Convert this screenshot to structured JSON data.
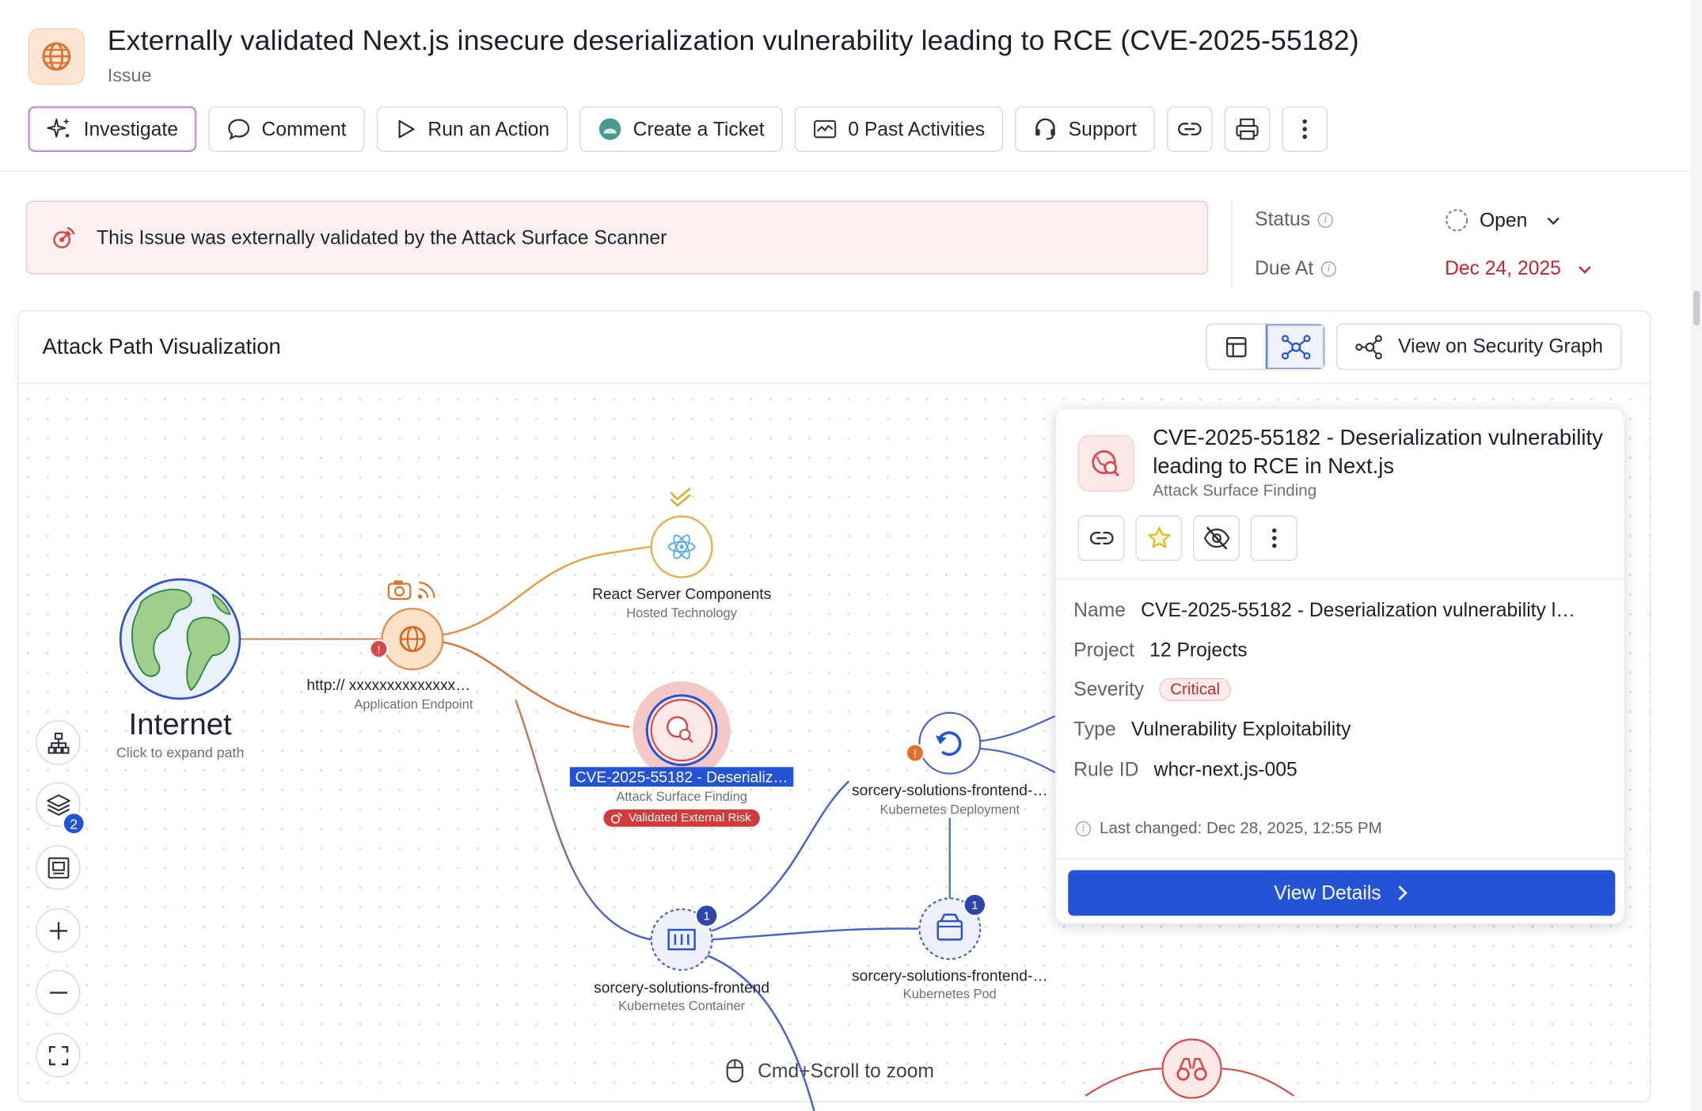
{
  "header": {
    "title": "Externally validated Next.js insecure deserialization vulnerability leading to RCE (CVE-2025-55182)",
    "subtitle": "Issue"
  },
  "toolbar": {
    "investigate": "Investigate",
    "comment": "Comment",
    "run_action": "Run an Action",
    "create_ticket": "Create a Ticket",
    "past_activities": "0 Past Activities",
    "support": "Support"
  },
  "banner": {
    "text": "This Issue was externally validated by the Attack Surface Scanner"
  },
  "meta": {
    "status_label": "Status",
    "status_value": "Open",
    "due_label": "Due At",
    "due_value": "Dec 24, 2025"
  },
  "panel": {
    "title": "Attack Path Visualization",
    "view_security_graph": "View on Security Graph",
    "zoom_hint": "Cmd+Scroll to zoom",
    "layers_badge": "2"
  },
  "graph": {
    "internet": {
      "label": "Internet",
      "sub": "Click to expand path"
    },
    "endpoint": {
      "label": "http:// xxxxxxxxxxxxxx…",
      "sub": "Application Endpoint"
    },
    "react": {
      "label": "React Server Components",
      "sub": "Hosted Technology"
    },
    "cve": {
      "label": "CVE-2025-55182 - Deserializ…",
      "sub": "Attack Surface Finding",
      "badge": "Validated External Risk"
    },
    "deployment": {
      "label": "sorcery-solutions-frontend-…",
      "sub": "Kubernetes Deployment"
    },
    "container": {
      "label": "sorcery-solutions-frontend",
      "sub": "Kubernetes Container",
      "count": "1"
    },
    "pod": {
      "label": "sorcery-solutions-frontend-…",
      "sub": "Kubernetes Pod",
      "count": "1"
    }
  },
  "popup": {
    "title": "CVE-2025-55182 - Deserialization vulnerability leading to RCE in Next.js",
    "subtitle": "Attack Surface Finding",
    "name_label": "Name",
    "name_value": "CVE-2025-55182 - Deserialization vulnerability l…",
    "project_label": "Project",
    "project_value": "12 Projects",
    "severity_label": "Severity",
    "severity_value": "Critical",
    "type_label": "Type",
    "type_value": "Vulnerability Exploitability",
    "rule_label": "Rule ID",
    "rule_value": "whcr-next.js-005",
    "last_changed": "Last changed: Dec 28, 2025, 12:55 PM",
    "view_details": "View Details"
  },
  "colors": {
    "accent_blue": "#2453d6",
    "critical_red": "#c0292f",
    "edge_orange": "#e07a3c",
    "edge_yellow": "#e0a84a",
    "edge_blue": "#4a63c8"
  }
}
